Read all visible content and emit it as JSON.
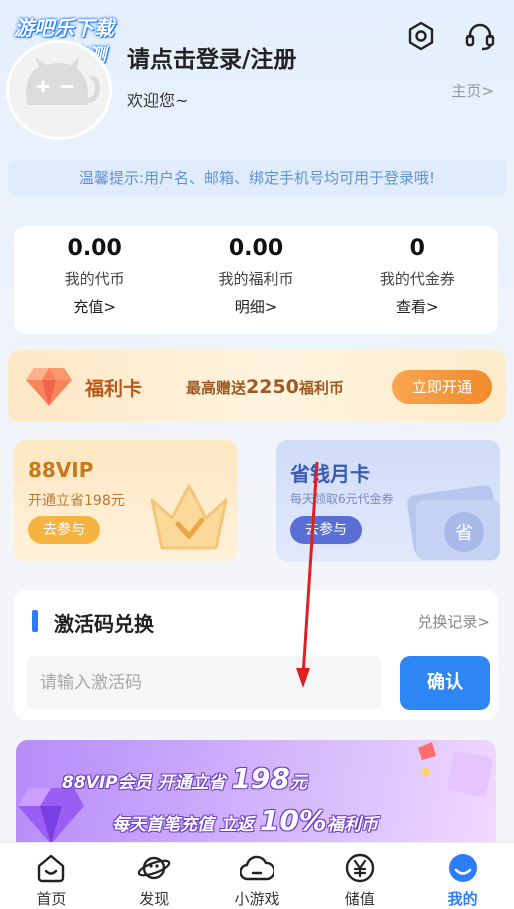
{
  "watermark": {
    "line1": "游吧乐下载",
    "line2": "小编亲测"
  },
  "header": {
    "title": "请点击登录/注册",
    "subtitle": "欢迎您~",
    "homepage_link": "主页>",
    "settings_icon": "hexagon-gear-icon",
    "service_icon": "headset-icon"
  },
  "tip": "温馨提示:用户名、邮箱、绑定手机号均可用于登录哦!",
  "stats": [
    {
      "value": "0.00",
      "label": "我的代币",
      "action": "充值>"
    },
    {
      "value": "0.00",
      "label": "我的福利币",
      "action": "明细>"
    },
    {
      "value": "0",
      "label": "我的代金券",
      "action": "查看>"
    }
  ],
  "welfare_card": {
    "title": "福利卡",
    "desc_prefix": "最高赠送",
    "desc_amount": "2250",
    "desc_suffix": "福利币",
    "button": "立即开通"
  },
  "promos": {
    "vip": {
      "title": "88VIP",
      "desc": "开通立省198元",
      "button": "去参与"
    },
    "monthly": {
      "title": "省钱月卡",
      "desc": "每天领取6元代金券",
      "button": "去参与",
      "stamp": "省"
    }
  },
  "redeem": {
    "title": "激活码兑换",
    "record_link": "兑换记录>",
    "placeholder": "请输入激活码",
    "value": "",
    "button": "确认"
  },
  "banner": {
    "line1_prefix": "88VIP会员 开通立省",
    "line1_num": "198",
    "line1_suffix": "元",
    "line2_prefix": "每天首笔充值 立返",
    "line2_num": "10%",
    "line2_suffix": "福利币"
  },
  "tabs": [
    {
      "label": "首页",
      "icon": "home-face-icon",
      "active": false
    },
    {
      "label": "发现",
      "icon": "planet-icon",
      "active": false
    },
    {
      "label": "小游戏",
      "icon": "cloud-icon",
      "active": false
    },
    {
      "label": "储值",
      "icon": "yen-coin-icon",
      "active": false
    },
    {
      "label": "我的",
      "icon": "profile-face-icon",
      "active": true
    }
  ],
  "colors": {
    "accent": "#2e7df6",
    "welfare_orange": "#f08b2c",
    "annotation_arrow": "#e02020"
  }
}
